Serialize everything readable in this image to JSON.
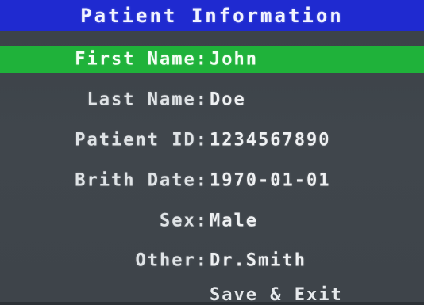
{
  "title": "Patient Information",
  "fields": [
    {
      "label": "First Name:",
      "value": "John",
      "selected": true
    },
    {
      "label": "Last Name:",
      "value": "Doe",
      "selected": false
    },
    {
      "label": "Patient ID:",
      "value": "1234567890",
      "selected": false
    },
    {
      "label": "Brith Date:",
      "value": "1970-01-01",
      "selected": false
    },
    {
      "label": "Sex:",
      "value": "Male",
      "selected": false
    },
    {
      "label": "Other:",
      "value": "Dr.Smith",
      "selected": false
    }
  ],
  "actions": {
    "save_exit": "Save & Exit"
  },
  "colors": {
    "title_bar": "#1f2ad0",
    "selected_row": "#1fb23a",
    "background": "#3e444a"
  }
}
